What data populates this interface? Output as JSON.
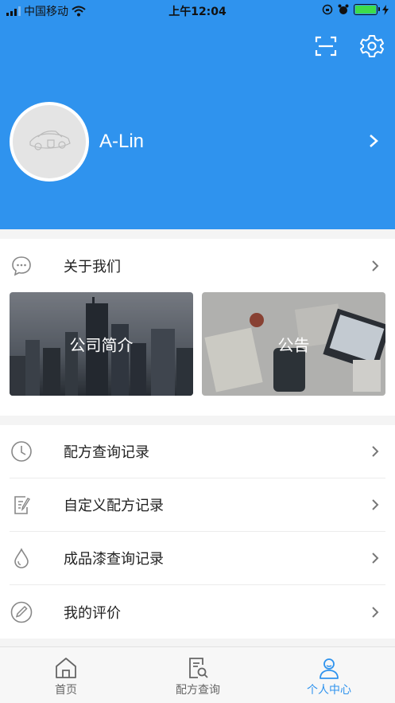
{
  "status_bar": {
    "carrier": "中国移动",
    "time": "上午12:04"
  },
  "header": {
    "username": "A-Lin",
    "scan_icon": "scan-icon",
    "settings_icon": "gear-icon"
  },
  "about": {
    "label": "关于我们",
    "tiles": [
      {
        "title": "公司简介"
      },
      {
        "title": "公告"
      }
    ]
  },
  "menu": [
    {
      "label": "配方查询记录",
      "icon": "clock-icon"
    },
    {
      "label": "自定义配方记录",
      "icon": "edit-note-icon"
    },
    {
      "label": "成品漆查询记录",
      "icon": "drop-icon"
    },
    {
      "label": "我的评价",
      "icon": "pencil-circle-icon"
    }
  ],
  "tabs": [
    {
      "label": "首页",
      "icon": "home-icon"
    },
    {
      "label": "配方查询",
      "icon": "formula-search-icon"
    },
    {
      "label": "个人中心",
      "icon": "person-icon",
      "active": true
    }
  ],
  "colors": {
    "primary": "#2f93ee",
    "background": "#f4f4f4"
  }
}
